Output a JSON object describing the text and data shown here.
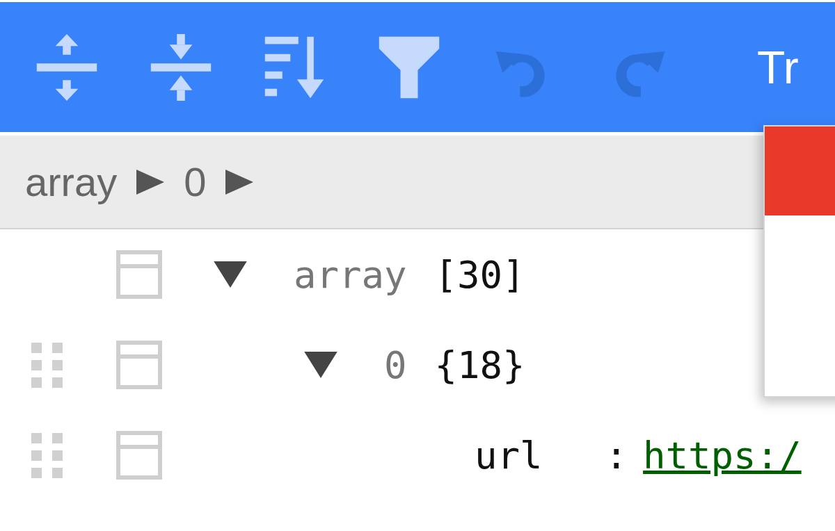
{
  "toolbar": {
    "buttons": [
      {
        "kind": "expand",
        "disabled": false
      },
      {
        "kind": "collapse",
        "disabled": false
      },
      {
        "kind": "sort",
        "disabled": false
      },
      {
        "kind": "filter",
        "disabled": false
      },
      {
        "kind": "undo",
        "disabled": true
      },
      {
        "kind": "redo",
        "disabled": true
      }
    ],
    "mode_label": "Tr"
  },
  "breadcrumb": [
    "array",
    "0"
  ],
  "tree": [
    {
      "key": "array",
      "readonly": true,
      "draggable": false,
      "count": "[30]",
      "expanded": true,
      "children": [
        {
          "key": "0",
          "readonly": true,
          "draggable": true,
          "count": "{18}",
          "expanded": true,
          "children": [
            {
              "key": "url",
              "readonly": false,
              "draggable": true,
              "separator": ":",
              "value": "https:/",
              "kind": "link"
            }
          ]
        }
      ]
    }
  ],
  "menu": {
    "open": true
  }
}
